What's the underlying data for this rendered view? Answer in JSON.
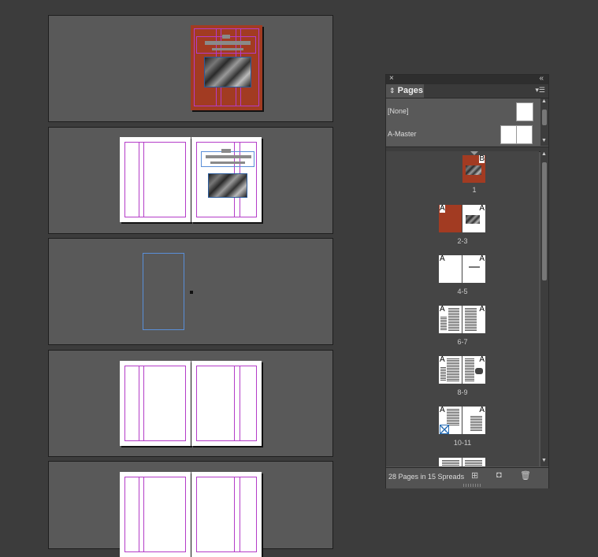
{
  "panel": {
    "close_glyph": "×",
    "collapse_glyph": "«",
    "tab_arrows": "⇕",
    "tab_label": "Pages",
    "menu_glyph": "▾☰",
    "masters": [
      {
        "label": "[None]"
      },
      {
        "label": "A-Master"
      }
    ],
    "spreads": [
      {
        "label": "1",
        "master_letters": [
          "B"
        ]
      },
      {
        "label": "2-3",
        "master_letters": [
          "A",
          "A"
        ]
      },
      {
        "label": "4-5",
        "master_letters": [
          "A",
          "A"
        ]
      },
      {
        "label": "6-7",
        "master_letters": [
          "A",
          "A"
        ]
      },
      {
        "label": "8-9",
        "master_letters": [
          "A",
          "A"
        ]
      },
      {
        "label": "10-11",
        "master_letters": [
          "A",
          "A"
        ]
      }
    ],
    "footer_status": "28 Pages in 15 Spreads",
    "footer_icons": [
      "page-size-icon",
      "new-page-icon",
      "trash-icon"
    ]
  },
  "colors": {
    "cover": "#a23b22",
    "margin_guide": "#b43cc8",
    "frame_blue": "#5a8fd8",
    "pasteboard": "#3c3c3c",
    "spread_bg": "#595959"
  }
}
